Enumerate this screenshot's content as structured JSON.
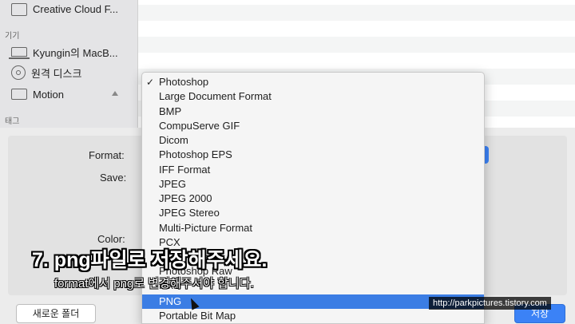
{
  "sidebar": {
    "top_item": "Creative Cloud F...",
    "devices_header": "기기",
    "devices": [
      "Kyungin의 MacB...",
      "원격 디스크",
      "Motion"
    ],
    "tags_header": "태그"
  },
  "options": {
    "format_label": "Format:",
    "save_label": "Save:",
    "color_label": "Color:"
  },
  "format_menu": {
    "checked_mark": "✓",
    "items": [
      "Photoshop",
      "Large Document Format",
      "BMP",
      "CompuServe GIF",
      "Dicom",
      "Photoshop EPS",
      "IFF Format",
      "JPEG",
      "JPEG 2000",
      "JPEG Stereo",
      "Multi-Picture Format",
      "PCX",
      "Photoshop Raw",
      "Pixar",
      "PNG",
      "Portable Bit Map"
    ],
    "checked_item": "Photoshop",
    "highlighted_item": "PNG"
  },
  "buttons": {
    "new_folder": "새로운 폴더",
    "save": "저장"
  },
  "overlay": {
    "caption_main": "7. png파일로 저장해주세요.",
    "caption_sub": "format에서 png로 변경해주셔야 합니다.",
    "watermark": "http://parkpictures.tistory.com"
  },
  "colors": {
    "highlight": "#3b7de4",
    "primary_button": "#3b82f6"
  }
}
